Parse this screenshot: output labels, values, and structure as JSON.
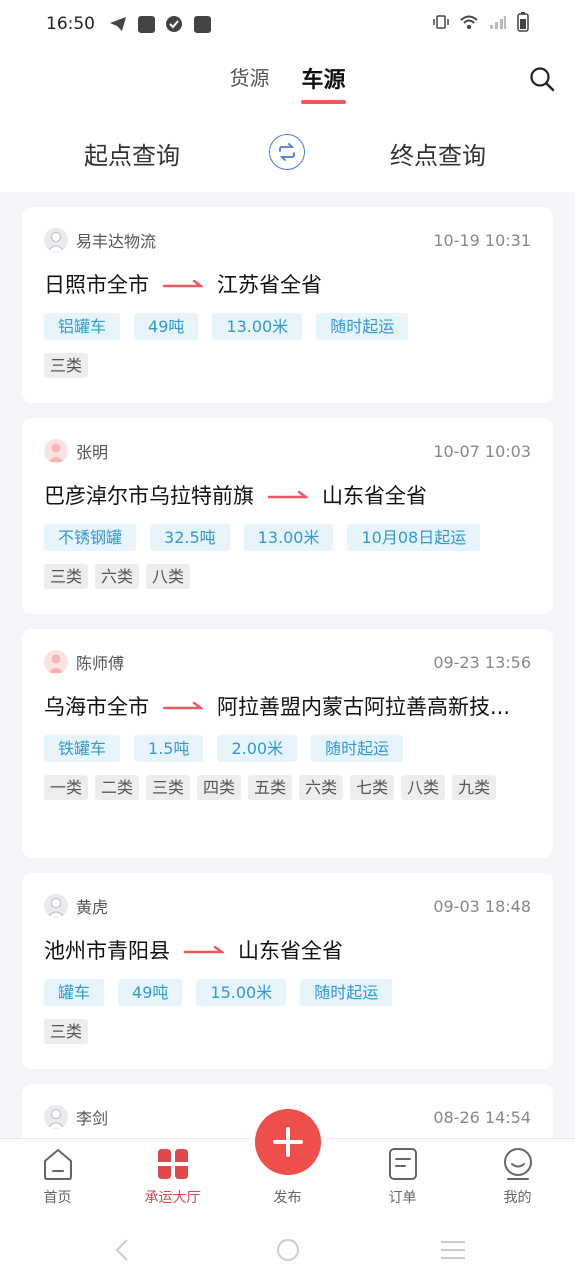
{
  "status": {
    "time": "16:50"
  },
  "header": {
    "tabs": [
      {
        "label": "货源"
      },
      {
        "label": "车源"
      }
    ],
    "query_start": "起点查询",
    "query_end": "终点查询"
  },
  "cards": [
    {
      "name": "易丰达物流",
      "time": "10-19 10:31",
      "origin": "日照市全市",
      "dest": "江苏省全省",
      "tags": [
        "铝罐车",
        "49吨",
        "13.00米",
        "随时起运"
      ],
      "cats": [
        "三类"
      ]
    },
    {
      "name": "张明",
      "time": "10-07 10:03",
      "origin": "巴彦淖尔市乌拉特前旗",
      "dest": "山东省全省",
      "tags": [
        "不锈钢罐",
        "32.5吨",
        "13.00米",
        "10月08日起运"
      ],
      "cats": [
        "三类",
        "六类",
        "八类"
      ]
    },
    {
      "name": "陈师傅",
      "time": "09-23 13:56",
      "origin": "乌海市全市",
      "dest": "阿拉善盟内蒙古阿拉善高新技...",
      "tags": [
        "铁罐车",
        "1.5吨",
        "2.00米",
        "随时起运"
      ],
      "cats": [
        "一类",
        "二类",
        "三类",
        "四类",
        "五类",
        "六类",
        "七类",
        "八类",
        "九类"
      ]
    },
    {
      "name": "黄虎",
      "time": "09-03 18:48",
      "origin": "池州市青阳县",
      "dest": "山东省全省",
      "tags": [
        "罐车",
        "49吨",
        "15.00米",
        "随时起运"
      ],
      "cats": [
        "三类"
      ]
    },
    {
      "name": "李剑",
      "time": "08-26 14:54",
      "origin": "",
      "dest": "",
      "tags": [],
      "cats": []
    }
  ],
  "tabbar": [
    {
      "label": "首页"
    },
    {
      "label": "承运大厅"
    },
    {
      "label": "发布"
    },
    {
      "label": "订单"
    },
    {
      "label": "我的"
    }
  ],
  "colors": {
    "accent": "#e85a5f",
    "tag_blue": "#2e9bd6",
    "swap_blue": "#4a7cd6"
  }
}
